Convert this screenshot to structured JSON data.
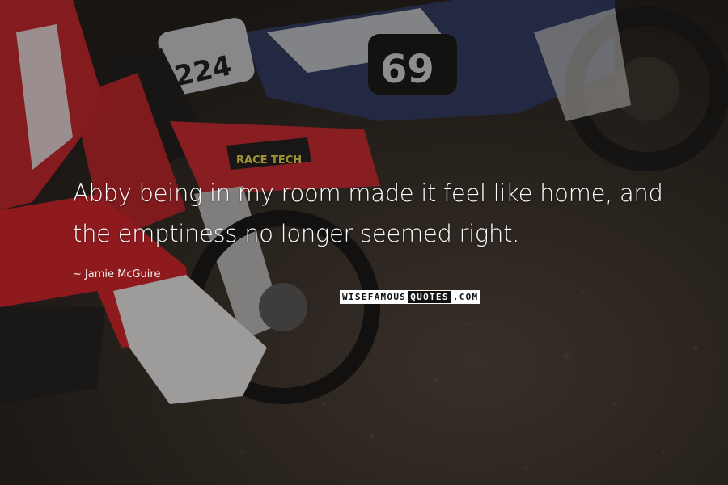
{
  "quote": {
    "line1": "Abby being in my room made it feel like home, and",
    "line2": "the emptiness no longer seemed right."
  },
  "author": {
    "prefix": "~",
    "name": "Jamie McGuire"
  },
  "brand": {
    "part_a": "WISEFAMOUS",
    "part_b": "QUOTES",
    "part_c": ".COM"
  },
  "photo": {
    "front_bike_label": "RACE TECH",
    "plate_left": "224",
    "plate_right": "69"
  },
  "colors": {
    "dirt": "#3a3029",
    "bike_red": "#c7262d",
    "rider_white": "#e6e6e6",
    "bike_blue": "#2d3b6a",
    "text": "#ffffff"
  }
}
